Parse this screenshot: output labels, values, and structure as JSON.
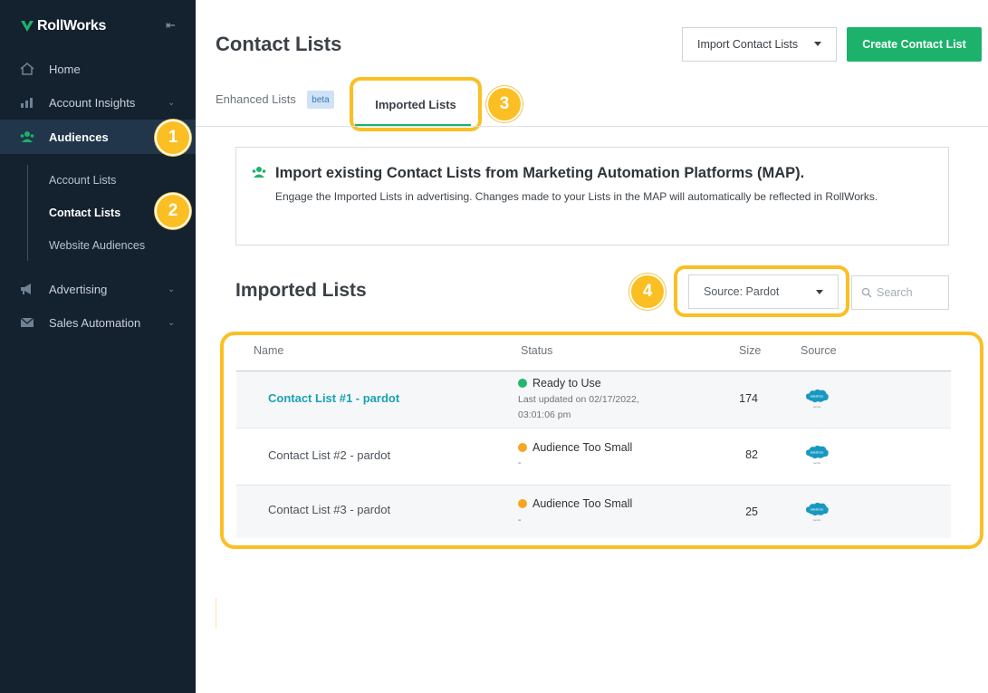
{
  "sidebar": {
    "logo_text": "RollWorks",
    "collapse_icon": "collapse-left-icon",
    "items": [
      {
        "label": "Home",
        "icon": "home-icon"
      },
      {
        "label": "Account Insights",
        "icon": "insights-icon"
      },
      {
        "label": "Audiences",
        "icon": "audiences-icon"
      },
      {
        "label": "Advertising",
        "icon": "megaphone-icon"
      },
      {
        "label": "Sales Automation",
        "icon": "mail-icon"
      }
    ],
    "subitems": [
      {
        "label": "Account Lists"
      },
      {
        "label": "Contact Lists"
      },
      {
        "label": "Website Audiences"
      }
    ]
  },
  "badges": [
    "1",
    "2",
    "3",
    "4"
  ],
  "header": {
    "title": "Contact Lists",
    "import_label": "Import Contact Lists",
    "create_label": "Create Contact List"
  },
  "tabs": {
    "enhanced": "Enhanced Lists",
    "beta": "beta",
    "imported": "Imported Lists"
  },
  "info": {
    "heading": "Import existing Contact Lists from Marketing Automation Platforms (MAP).",
    "body": "Engage the Imported Lists in advertising. Changes made to your Lists in the MAP will automatically be reflected in RollWorks."
  },
  "section": {
    "title": "Imported Lists",
    "source_label": "Source: Pardot",
    "search_placeholder": "Search"
  },
  "table": {
    "columns": [
      "Name",
      "Status",
      "Size",
      "Source"
    ],
    "rows": [
      {
        "name": "Contact List #1 - pardot",
        "status": "Ready to Use",
        "status_color": "#22b86b",
        "sub1": "Last updated on 02/17/2022,",
        "sub2": "03:01:06 pm",
        "size": "174",
        "source_icon": "salesforce-pardot-icon"
      },
      {
        "name": "Contact List #2 - pardot",
        "status": "Audience Too Small",
        "status_color": "#f5a623",
        "sub1": "-",
        "size": "82",
        "source_icon": "salesforce-pardot-icon"
      },
      {
        "name": "Contact List #3 - pardot",
        "status": "Audience Too Small",
        "status_color": "#f5a623",
        "sub1": "-",
        "size": "25",
        "source_icon": "salesforce-pardot-icon"
      }
    ]
  },
  "colors": {
    "sidebar_bg": "#14212e",
    "accent_green": "#1db26b",
    "link_teal": "#1aa2b5",
    "highlight_yellow": "#fbbf24"
  }
}
